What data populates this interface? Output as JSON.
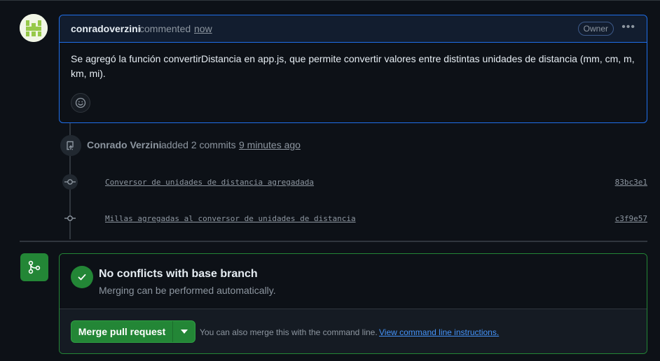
{
  "comment": {
    "author": "conradoverzini",
    "verb": "commented",
    "time": "now",
    "badge": "Owner",
    "body": "Se agregó la función convertirDistancia en app.js, que permite convertir valores entre distintas unidades de distancia (mm, cm, m, km, mi)."
  },
  "event": {
    "actor": "Conrado Verzini",
    "action": "added 2 commits",
    "time": "9 minutes ago"
  },
  "commits": [
    {
      "message": "Conversor de unidades de distancia agregadada",
      "sha": "83bc3e1"
    },
    {
      "message": "Millas agregadas al conversor de unidades de distancia",
      "sha": "c3f9e57"
    }
  ],
  "merge": {
    "title": "No conflicts with base branch",
    "subtitle": "Merging can be performed automatically.",
    "button_label": "Merge pull request",
    "hint": "You can also merge this with the command line.",
    "link": "View command line instructions."
  },
  "colors": {
    "accent_blue": "#1f6feb",
    "success_green": "#238636",
    "link": "#4493f8",
    "background": "#0d1117"
  }
}
